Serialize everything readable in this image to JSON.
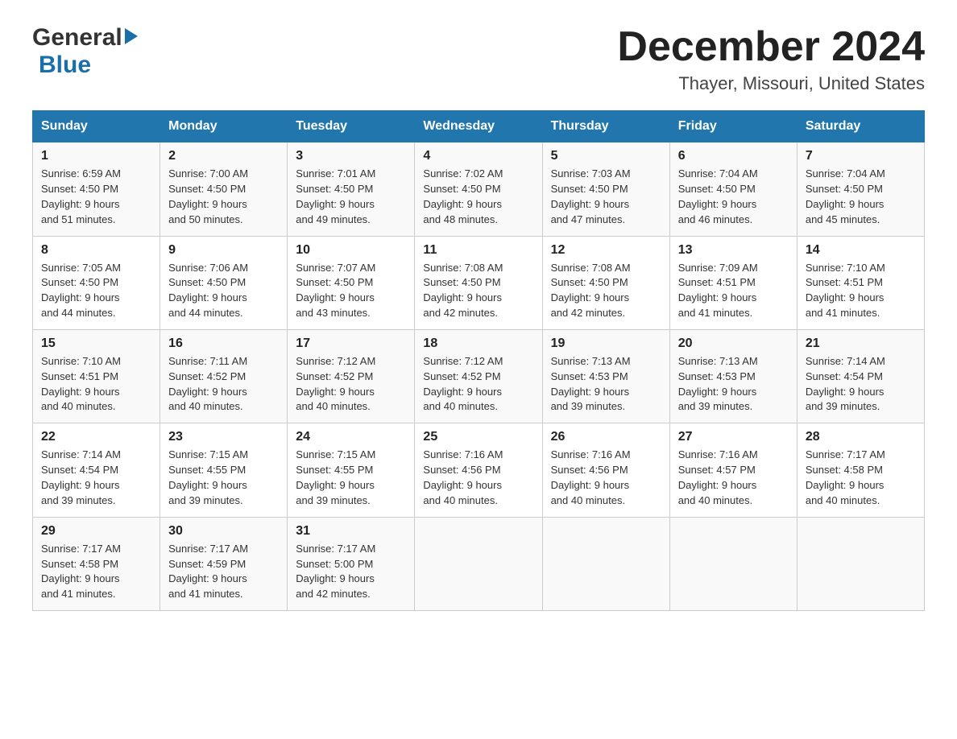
{
  "logo": {
    "general": "General",
    "blue": "Blue"
  },
  "title": {
    "month_year": "December 2024",
    "location": "Thayer, Missouri, United States"
  },
  "calendar": {
    "headers": [
      "Sunday",
      "Monday",
      "Tuesday",
      "Wednesday",
      "Thursday",
      "Friday",
      "Saturday"
    ],
    "weeks": [
      [
        {
          "day": "1",
          "sunrise": "6:59 AM",
          "sunset": "4:50 PM",
          "daylight": "9 hours and 51 minutes."
        },
        {
          "day": "2",
          "sunrise": "7:00 AM",
          "sunset": "4:50 PM",
          "daylight": "9 hours and 50 minutes."
        },
        {
          "day": "3",
          "sunrise": "7:01 AM",
          "sunset": "4:50 PM",
          "daylight": "9 hours and 49 minutes."
        },
        {
          "day": "4",
          "sunrise": "7:02 AM",
          "sunset": "4:50 PM",
          "daylight": "9 hours and 48 minutes."
        },
        {
          "day": "5",
          "sunrise": "7:03 AM",
          "sunset": "4:50 PM",
          "daylight": "9 hours and 47 minutes."
        },
        {
          "day": "6",
          "sunrise": "7:04 AM",
          "sunset": "4:50 PM",
          "daylight": "9 hours and 46 minutes."
        },
        {
          "day": "7",
          "sunrise": "7:04 AM",
          "sunset": "4:50 PM",
          "daylight": "9 hours and 45 minutes."
        }
      ],
      [
        {
          "day": "8",
          "sunrise": "7:05 AM",
          "sunset": "4:50 PM",
          "daylight": "9 hours and 44 minutes."
        },
        {
          "day": "9",
          "sunrise": "7:06 AM",
          "sunset": "4:50 PM",
          "daylight": "9 hours and 44 minutes."
        },
        {
          "day": "10",
          "sunrise": "7:07 AM",
          "sunset": "4:50 PM",
          "daylight": "9 hours and 43 minutes."
        },
        {
          "day": "11",
          "sunrise": "7:08 AM",
          "sunset": "4:50 PM",
          "daylight": "9 hours and 42 minutes."
        },
        {
          "day": "12",
          "sunrise": "7:08 AM",
          "sunset": "4:50 PM",
          "daylight": "9 hours and 42 minutes."
        },
        {
          "day": "13",
          "sunrise": "7:09 AM",
          "sunset": "4:51 PM",
          "daylight": "9 hours and 41 minutes."
        },
        {
          "day": "14",
          "sunrise": "7:10 AM",
          "sunset": "4:51 PM",
          "daylight": "9 hours and 41 minutes."
        }
      ],
      [
        {
          "day": "15",
          "sunrise": "7:10 AM",
          "sunset": "4:51 PM",
          "daylight": "9 hours and 40 minutes."
        },
        {
          "day": "16",
          "sunrise": "7:11 AM",
          "sunset": "4:52 PM",
          "daylight": "9 hours and 40 minutes."
        },
        {
          "day": "17",
          "sunrise": "7:12 AM",
          "sunset": "4:52 PM",
          "daylight": "9 hours and 40 minutes."
        },
        {
          "day": "18",
          "sunrise": "7:12 AM",
          "sunset": "4:52 PM",
          "daylight": "9 hours and 40 minutes."
        },
        {
          "day": "19",
          "sunrise": "7:13 AM",
          "sunset": "4:53 PM",
          "daylight": "9 hours and 39 minutes."
        },
        {
          "day": "20",
          "sunrise": "7:13 AM",
          "sunset": "4:53 PM",
          "daylight": "9 hours and 39 minutes."
        },
        {
          "day": "21",
          "sunrise": "7:14 AM",
          "sunset": "4:54 PM",
          "daylight": "9 hours and 39 minutes."
        }
      ],
      [
        {
          "day": "22",
          "sunrise": "7:14 AM",
          "sunset": "4:54 PM",
          "daylight": "9 hours and 39 minutes."
        },
        {
          "day": "23",
          "sunrise": "7:15 AM",
          "sunset": "4:55 PM",
          "daylight": "9 hours and 39 minutes."
        },
        {
          "day": "24",
          "sunrise": "7:15 AM",
          "sunset": "4:55 PM",
          "daylight": "9 hours and 39 minutes."
        },
        {
          "day": "25",
          "sunrise": "7:16 AM",
          "sunset": "4:56 PM",
          "daylight": "9 hours and 40 minutes."
        },
        {
          "day": "26",
          "sunrise": "7:16 AM",
          "sunset": "4:56 PM",
          "daylight": "9 hours and 40 minutes."
        },
        {
          "day": "27",
          "sunrise": "7:16 AM",
          "sunset": "4:57 PM",
          "daylight": "9 hours and 40 minutes."
        },
        {
          "day": "28",
          "sunrise": "7:17 AM",
          "sunset": "4:58 PM",
          "daylight": "9 hours and 40 minutes."
        }
      ],
      [
        {
          "day": "29",
          "sunrise": "7:17 AM",
          "sunset": "4:58 PM",
          "daylight": "9 hours and 41 minutes."
        },
        {
          "day": "30",
          "sunrise": "7:17 AM",
          "sunset": "4:59 PM",
          "daylight": "9 hours and 41 minutes."
        },
        {
          "day": "31",
          "sunrise": "7:17 AM",
          "sunset": "5:00 PM",
          "daylight": "9 hours and 42 minutes."
        },
        null,
        null,
        null,
        null
      ]
    ]
  }
}
